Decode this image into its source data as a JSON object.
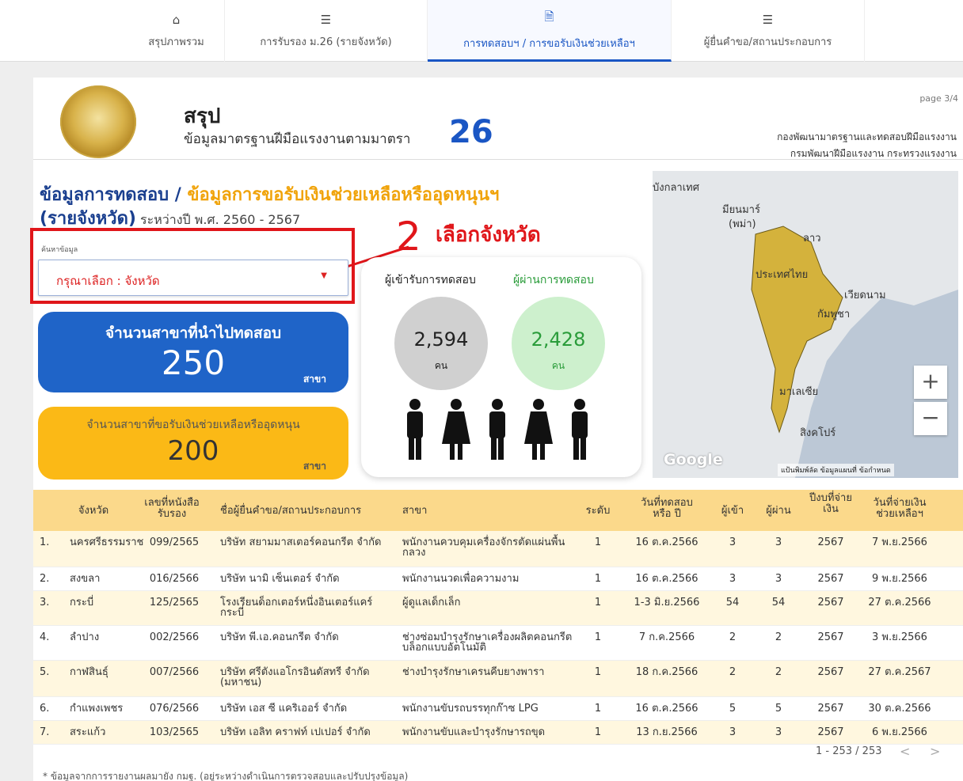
{
  "nav": {
    "tabs": [
      {
        "label": "สรุปภาพรวม",
        "icon": "home-icon"
      },
      {
        "label": "การรับรอง ม.26 (รายจังหวัด)",
        "icon": "list-icon"
      },
      {
        "label": "การทดสอบฯ / การขอรับเงินช่วยเหลือฯ",
        "icon": "document-icon"
      },
      {
        "label": "ผู้ยื่นคำขอ/สถานประกอบการ",
        "icon": "list-icon"
      }
    ]
  },
  "header": {
    "title": "สรุป",
    "subtitle": "ข้อมูลมาตรฐานฝีมือแรงงานตามมาตรา",
    "section_number": "26",
    "page": "page 3/4",
    "org_line1": "กองพัฒนามาตรฐานและทดสอบฝีมือแรงงาน",
    "org_line2": "กรมพัฒนาฝีมือแรงงาน กระทรวงแรงงาน"
  },
  "section": {
    "title_part1": "ข้อมูลการทดสอบ / ",
    "title_part2": "ข้อมูลการขอรับเงินช่วยเหลือหรืออุดหนุนฯ",
    "title_line2": "(รายจังหวัด)",
    "period": " ระหว่างปี พ.ศ. 2560 - 2567"
  },
  "annotation": {
    "number": "2",
    "text": "เลือกจังหวัด"
  },
  "search": {
    "label": "ค้นหาข้อมูล",
    "value": "กรุณาเลือก : จังหวัด"
  },
  "kpi_tested": {
    "label": "จำนวนสาขาที่นำไปทดสอบ",
    "value": "250",
    "unit": "สาขา"
  },
  "kpi_funded": {
    "label": "จำนวนสาขาที่ขอรับเงินช่วยเหลือหรืออุดหนุน",
    "value": "200",
    "unit": "สาขา"
  },
  "people": {
    "examinees_label": "ผู้เข้ารับการทดสอบ",
    "passed_label": "ผู้ผ่านการทดสอบ",
    "examinees": "2,594",
    "passed": "2,428",
    "unit": "คน"
  },
  "map": {
    "labels": [
      "มียนมาร์",
      "(พม่า)",
      "ลาว",
      "ประเทศไทย",
      "เวียดนาม",
      "กัมพูชา",
      "มาเลเซีย",
      "สิงคโปร์",
      "บังกลาเทศ"
    ],
    "brand": "Google",
    "footer": "แป้นพิมพ์ลัด   ข้อมูลแผนที่   ข้อกำหนด",
    "zoom_in": "+",
    "zoom_out": "−"
  },
  "table": {
    "headers": [
      "จังหวัด",
      "เลขที่หนังสือรับรอง",
      "ชื่อผู้ยื่นคำขอ/สถานประกอบการ",
      "สาขา",
      "ระดับ",
      "วันที่ทดสอบหรือ ปี",
      "ผู้เข้า",
      "ผู้ผ่าน",
      "ปีงบที่จ่ายเงิน",
      "วันที่จ่ายเงินช่วยเหลือฯ"
    ],
    "rows": [
      [
        "1.",
        "นครศรีธรรมราช",
        "099/2565",
        "บริษัท สยามมาสเตอร์คอนกรีต จำกัด",
        "พนักงานควบคุมเครื่องจักรตัดแผ่นพื้นกลวง",
        "1",
        "16 ต.ค.2566",
        "3",
        "3",
        "2567",
        "7 พ.ย.2566"
      ],
      [
        "2.",
        "สงขลา",
        "016/2566",
        "บริษัท นามิ เซ็นเตอร์ จำกัด",
        "พนักงานนวดเพื่อความงาม",
        "1",
        "16 ต.ค.2566",
        "3",
        "3",
        "2567",
        "9 พ.ย.2566"
      ],
      [
        "3.",
        "กระบี่",
        "125/2565",
        "โรงเรียนด็อกเตอร์หนึ่งอินเตอร์แคร์ กระบี่",
        "ผู้ดูแลเด็กเล็ก",
        "1",
        "1-3 มิ.ย.2566",
        "54",
        "54",
        "2567",
        "27 ต.ค.2566"
      ],
      [
        "4.",
        "ลำปาง",
        "002/2566",
        "บริษัท พี.เอ.คอนกรีต จำกัด",
        "ช่างซ่อมบำรุงรักษาเครื่องผลิตคอนกรีตบล็อกแบบอัตโนมัติ",
        "1",
        "7 ก.ค.2566",
        "2",
        "2",
        "2567",
        "3 พ.ย.2566"
      ],
      [
        "5.",
        "กาฬสินธุ์",
        "007/2566",
        "บริษัท ศรีตังแอโกรอินดัสทรี จำกัด (มหาชน)",
        "ช่างบำรุงรักษาเครนคีบยางพารา",
        "1",
        "18 ก.ค.2566",
        "2",
        "2",
        "2567",
        "27 ต.ค.2567"
      ],
      [
        "6.",
        "กำแพงเพชร",
        "076/2566",
        "บริษัท เอส ซี แคริเออร์ จำกัด",
        "พนักงานขับรถบรรทุกก๊าซ LPG",
        "1",
        "16 ต.ค.2566",
        "5",
        "5",
        "2567",
        "30 ต.ค.2566"
      ],
      [
        "7.",
        "สระแก้ว",
        "103/2565",
        "บริษัท เอลิท คราฟท์ เปเปอร์ จำกัด",
        "พนักงานขับและบำรุงรักษารถขุด",
        "1",
        "13 ก.ย.2566",
        "3",
        "3",
        "2567",
        "6 พ.ย.2566"
      ]
    ],
    "pager": "1 - 253 / 253",
    "prev": "<",
    "next": ">"
  },
  "footnote": "* ข้อมูลจากการรายงานผลมายัง กมฐ. (อยู่ระหว่างดำเนินการตรวจสอบและปรับปรุงข้อมูล)",
  "colors": {
    "accent": "#1a56c4",
    "kpi_blue": "#1f64c8",
    "kpi_yellow": "#fbb916",
    "annotation_red": "#e0161a",
    "table_header": "#fbd98b",
    "passed_green": "#2a9c3a"
  }
}
